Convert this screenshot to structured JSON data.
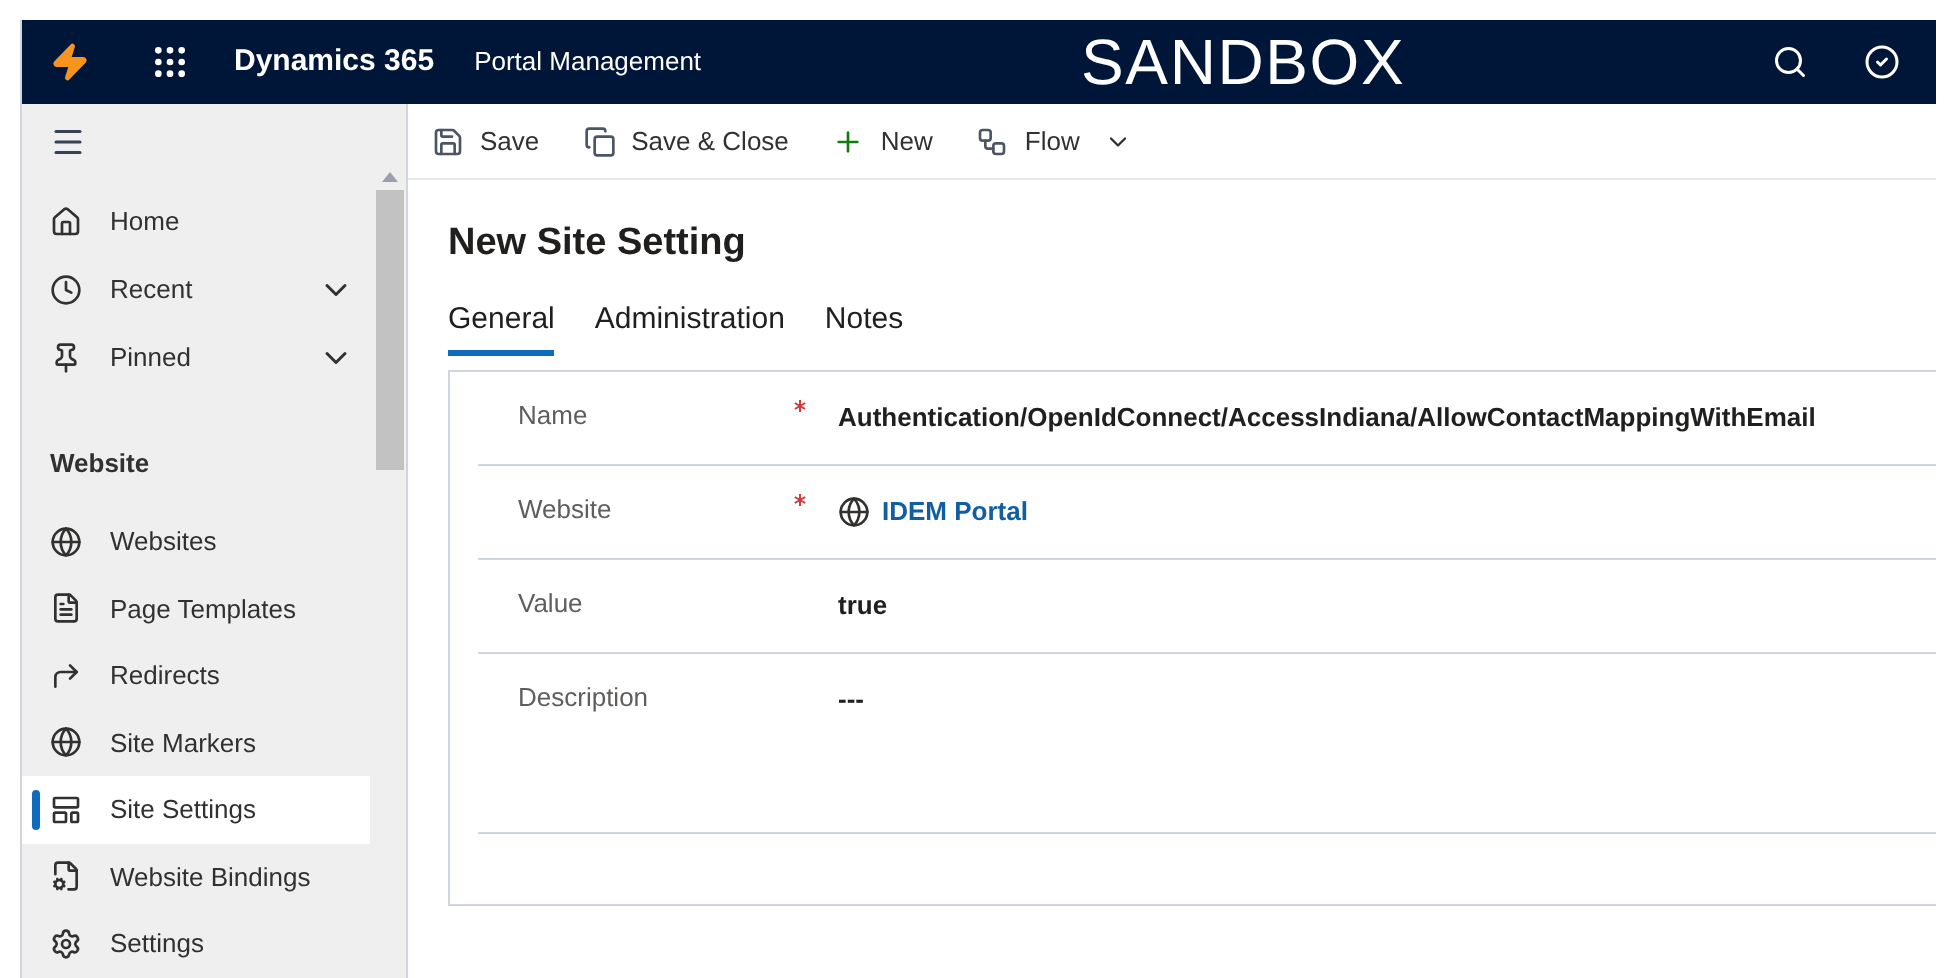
{
  "header": {
    "app_name": "Dynamics 365",
    "area": "Portal Management",
    "banner": "SANDBOX"
  },
  "sidebar": {
    "top_items": [
      {
        "label": "Home",
        "expandable": false
      },
      {
        "label": "Recent",
        "expandable": true,
        "expanded": false
      },
      {
        "label": "Pinned",
        "expandable": true,
        "expanded": false
      }
    ],
    "section": "Website",
    "items": [
      {
        "label": "Websites",
        "selected": false
      },
      {
        "label": "Page Templates",
        "selected": false
      },
      {
        "label": "Redirects",
        "selected": false
      },
      {
        "label": "Site Markers",
        "selected": false
      },
      {
        "label": "Site Settings",
        "selected": true
      },
      {
        "label": "Website Bindings",
        "selected": false
      },
      {
        "label": "Settings",
        "selected": false
      }
    ]
  },
  "toolbar": [
    "Save",
    "Save & Close",
    "New",
    "Flow"
  ],
  "form": {
    "title": "New Site Setting",
    "tabs": [
      {
        "label": "General",
        "selected": true
      },
      {
        "label": "Administration",
        "selected": false
      },
      {
        "label": "Notes",
        "selected": false
      }
    ],
    "fields": [
      {
        "label": "Name",
        "required": true,
        "kind": "text",
        "value": "Authentication/OpenIdConnect/AccessIndiana/AllowContactMappingWithEmail"
      },
      {
        "label": "Website",
        "required": true,
        "kind": "lookup",
        "value": "IDEM Portal"
      },
      {
        "label": "Value",
        "required": false,
        "kind": "text",
        "value": "true"
      },
      {
        "label": "Description",
        "required": false,
        "kind": "multiline",
        "value": "---"
      }
    ]
  }
}
